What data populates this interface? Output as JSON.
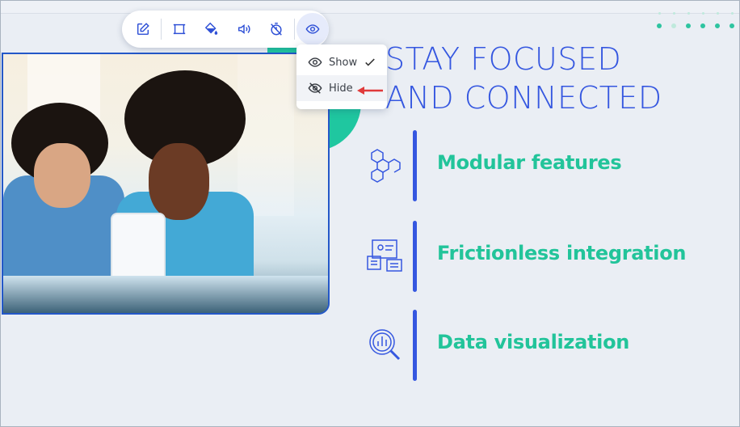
{
  "toolbar": {
    "buttons": [
      {
        "name": "edit",
        "icon": "pencil-square-icon"
      },
      {
        "name": "crop",
        "icon": "crop-frame-icon"
      },
      {
        "name": "fill",
        "icon": "paint-bucket-icon"
      },
      {
        "name": "audio",
        "icon": "volume-icon"
      },
      {
        "name": "timer",
        "icon": "timer-off-icon"
      },
      {
        "name": "visibility",
        "icon": "eye-icon",
        "active": true
      }
    ]
  },
  "visibility_menu": {
    "items": [
      {
        "label": "Show",
        "icon": "eye-icon",
        "checked": true
      },
      {
        "label": "Hide",
        "icon": "eye-off-icon",
        "checked": false
      }
    ]
  },
  "slide": {
    "title_line1": "STAY FOCUSED",
    "title_line2": "AND CONNECTED",
    "features": [
      {
        "label": "Modular features",
        "icon": "cubes-icon"
      },
      {
        "label": "Frictionless integration",
        "icon": "integration-icon"
      },
      {
        "label": "Data visualization",
        "icon": "chart-magnifier-icon"
      }
    ]
  },
  "colors": {
    "accent_blue": "#3557e0",
    "accent_green": "#22c49a",
    "selection_border": "#2458c8"
  }
}
